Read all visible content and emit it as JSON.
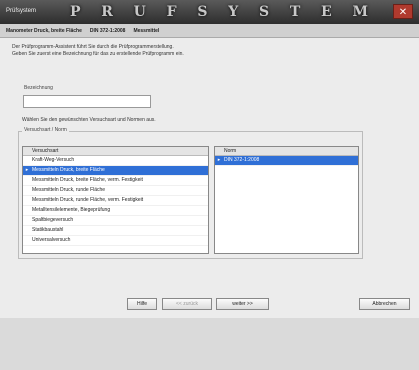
{
  "window": {
    "title": "Prüfsystem",
    "brand_letters": [
      "P",
      "R",
      "U",
      "F",
      "S",
      "Y",
      "S",
      "T",
      "E",
      "M"
    ],
    "close_glyph": "✕"
  },
  "header": {
    "items": [
      "Manometer Druck, breite Fläche",
      "DIN 372-1:2008",
      "Messmittel"
    ]
  },
  "intro": {
    "line1": "Der Prüfprogramm-Assistent führt Sie durch die Prüfprogrammerstellung.",
    "line2": "Geben Sie zuerst eine Bezeichnung für das zu erstellende Prüfprogramm ein."
  },
  "bezeichnung": {
    "label": "Bezeichnung",
    "value": ""
  },
  "select_hint": "Wählen Sie den gewünschten Versuchsart und Normen aus.",
  "group": {
    "label": "Versuchsart / Norm"
  },
  "left_list": {
    "header": "Versuchsart",
    "rows": [
      {
        "label": "Kraft-Weg-Versuch",
        "selected": false
      },
      {
        "label": "Messmitteln Druck, breite Fläche",
        "selected": true
      },
      {
        "label": "Messmitteln Druck, breite Fläche, verm. Festigkeit",
        "selected": false
      },
      {
        "label": "Messmitteln Druck, runde Fläche",
        "selected": false
      },
      {
        "label": "Messmitteln Druck, runde Fläche, verm. Festigkeit",
        "selected": false
      },
      {
        "label": "Metalltensilelemente, Biegeprüfung",
        "selected": false
      },
      {
        "label": "Spaltbiegeversuch",
        "selected": false
      },
      {
        "label": "Statikbaustahl",
        "selected": false
      },
      {
        "label": "Universalversuch",
        "selected": false
      }
    ]
  },
  "right_list": {
    "header": "Norm",
    "rows": [
      {
        "label": "DIN 372-1:2008",
        "selected": true
      }
    ]
  },
  "buttons": {
    "help": "Hilfe",
    "back": "<< zurück",
    "next": "weiter >>",
    "cancel": "Abbrechen"
  }
}
